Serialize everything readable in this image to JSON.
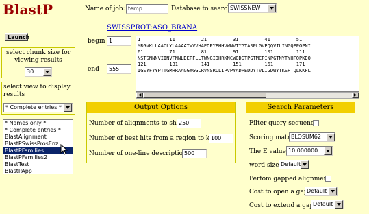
{
  "app": {
    "title": "BlastP"
  },
  "header": {
    "job_label": "Name of job:",
    "job_value": "temp",
    "db_label": "Database to search:",
    "db_value": "SWISSNEW"
  },
  "left": {
    "launch_label": "Launch",
    "chunk_label": "select chunk size for viewing results",
    "chunk_value": "30",
    "view_label": "select view to display results",
    "view_value": "* Complete entries *",
    "view_options": [
      "* Names only *",
      "* Complete entries *",
      "BlastAlignment",
      "BlastPSwissProsEnz",
      "BlastPFamilies",
      "BlastPFamilies2",
      "BlastTest",
      "BlastPApp"
    ],
    "view_highlighted_index": 4
  },
  "sequence": {
    "name": "SWISSPROT:ASO_BRANA",
    "begin_label": "begin",
    "begin_value": "1",
    "end_label": "end",
    "end_value": "555",
    "lines": [
      "1          11         21         31         41         51",
      "MRGVKLLAACLYLAAAATVVVHAEDPYFHHVWNVTYGTASPLGVPQQVILINGQFPGPNI",
      "61         71         81         91         101        111",
      "NSTSNNNVIINVFNNLDEPFLLTWNGIQHRKNCWQDGTPGTMCPINPGTNYTYHFQPKDQ",
      "121        131        141        151        161        171",
      "IGSYFYYPTTGMHRAAGGYGGLRVNSRLLIPVPYADPEDDYTVLIGDWYTKSHTQLKKFL"
    ]
  },
  "output_options": {
    "title": "Output Options",
    "alignments_label": "Number of alignments to show",
    "alignments_value": "250",
    "besthits_label": "Number of best hits from a region to keep",
    "besthits_value": "100",
    "oneline_label": "Number of one-line descriptions",
    "oneline_value": "500"
  },
  "search_params": {
    "title": "Search Parameters",
    "filter_label": "Filter query sequence",
    "matrix_label": "Scoring matrix",
    "matrix_value": "BLOSUM62",
    "evalue_label": "The E value",
    "evalue_value": "10.000000",
    "wordsize_label": "word size",
    "wordsize_value": "Default",
    "gapped_label": "Perfom gapped alignment",
    "gapopen_label": "Cost to open a gap",
    "gapopen_value": "Default",
    "gapextend_label": "Cost to extend a gap",
    "gapextend_value": "Default"
  }
}
